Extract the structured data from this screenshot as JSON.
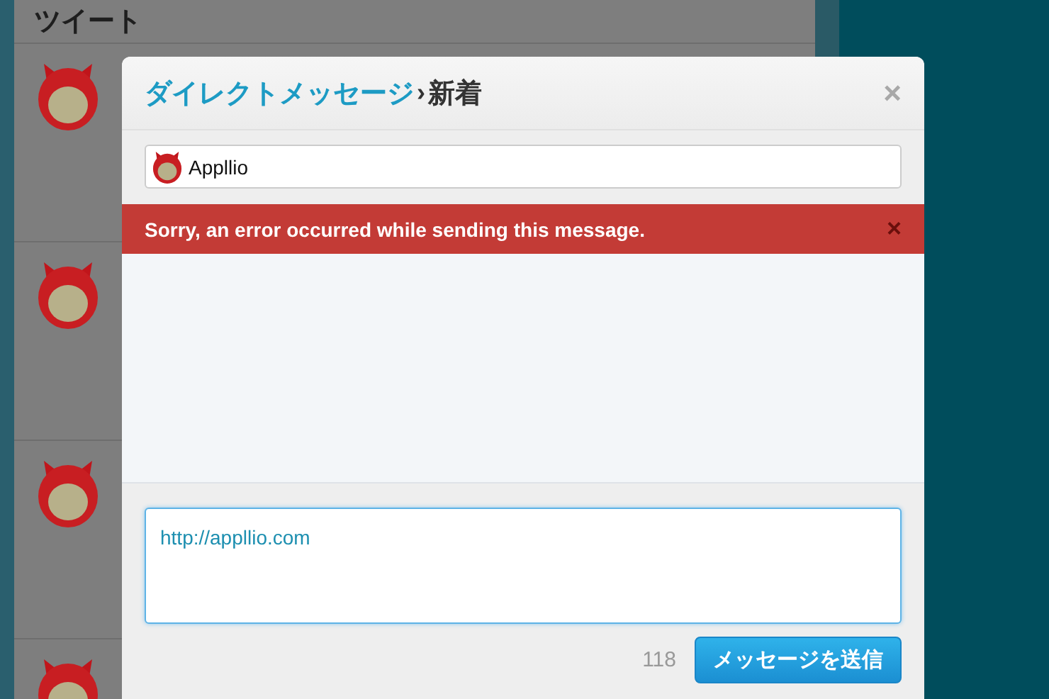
{
  "timeline": {
    "title": "ツイート"
  },
  "dialog": {
    "title": "ダイレクトメッセージ",
    "separator": "›",
    "subtitle": "新着",
    "close": "×",
    "recipient": {
      "value": "Appllio"
    },
    "error": {
      "message": "Sorry, an error occurred while sending this message.",
      "close": "×"
    },
    "message": {
      "value": "http://appllio.com"
    },
    "counter": "118",
    "send_button": "メッセージを送信"
  }
}
